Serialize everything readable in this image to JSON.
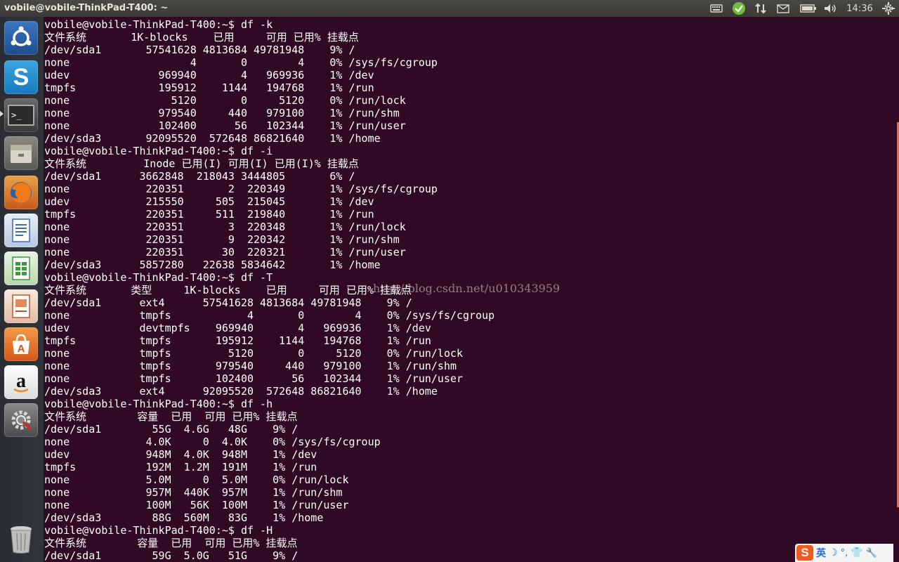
{
  "window": {
    "title": "vobile@vobile-ThinkPad-T400: ~"
  },
  "tray": {
    "time": "14:36",
    "icons": [
      "keyboard-icon",
      "update-check-icon",
      "network-arrows-icon",
      "mail-icon",
      "battery-icon",
      "volume-icon",
      "gear-icon"
    ]
  },
  "launcher": {
    "items": [
      "ubuntu-dash-icon",
      "skype-icon",
      "terminal-icon",
      "file-manager-icon",
      "firefox-icon",
      "writer-icon",
      "calc-icon",
      "impress-icon",
      "software-center-icon",
      "amazon-icon",
      "system-settings-icon",
      "trash-icon"
    ]
  },
  "terminal": {
    "lines": [
      "vobile@vobile-ThinkPad-T400:~$ df -k",
      "文件系统       1K-blocks    已用     可用 已用% 挂载点",
      "/dev/sda1       57541628 4813684 49781948    9% /",
      "none                   4       0        4    0% /sys/fs/cgroup",
      "udev              969940       4   969936    1% /dev",
      "tmpfs             195912    1144   194768    1% /run",
      "none                5120       0     5120    0% /run/lock",
      "none              979540     440   979100    1% /run/shm",
      "none              102400      56   102344    1% /run/user",
      "/dev/sda3       92095520  572648 86821640    1% /home",
      "vobile@vobile-ThinkPad-T400:~$ df -i",
      "文件系统         Inode 已用(I) 可用(I) 已用(I)% 挂载点",
      "/dev/sda1      3662848  218043 3444805       6% /",
      "none            220351       2  220349       1% /sys/fs/cgroup",
      "udev            215550     505  215045       1% /dev",
      "tmpfs           220351     511  219840       1% /run",
      "none            220351       3  220348       1% /run/lock",
      "none            220351       9  220342       1% /run/shm",
      "none            220351      30  220321       1% /run/user",
      "/dev/sda3      5857280   22638 5834642       1% /home",
      "vobile@vobile-ThinkPad-T400:~$ df -T",
      "文件系统       类型     1K-blocks    已用     可用 已用% 挂载点",
      "/dev/sda1      ext4      57541628 4813684 49781948    9% /",
      "none           tmpfs            4       0        4    0% /sys/fs/cgroup",
      "udev           devtmpfs    969940       4   969936    1% /dev",
      "tmpfs          tmpfs       195912    1144   194768    1% /run",
      "none           tmpfs         5120       0     5120    0% /run/lock",
      "none           tmpfs       979540     440   979100    1% /run/shm",
      "none           tmpfs       102400      56   102344    1% /run/user",
      "/dev/sda3      ext4      92095520  572648 86821640    1% /home",
      "vobile@vobile-ThinkPad-T400:~$ df -h",
      "文件系统        容量  已用  可用 已用% 挂载点",
      "/dev/sda1        55G  4.6G   48G    9% /",
      "none            4.0K     0  4.0K    0% /sys/fs/cgroup",
      "udev            948M  4.0K  948M    1% /dev",
      "tmpfs           192M  1.2M  191M    1% /run",
      "none            5.0M     0  5.0M    0% /run/lock",
      "none            957M  440K  957M    1% /run/shm",
      "none            100M   56K  100M    1% /run/user",
      "/dev/sda3        88G  560M   83G    1% /home",
      "vobile@vobile-ThinkPad-T400:~$ df -H",
      "文件系统        容量  已用  可用 已用% 挂载点",
      "/dev/sda1        59G  5.0G   51G    9% /"
    ]
  },
  "watermark": "http://blog.csdn.net/u010343959",
  "ime": {
    "label": "英"
  },
  "colors": {
    "terminal_bg": "#300a24",
    "accent": "#f26b3a"
  }
}
